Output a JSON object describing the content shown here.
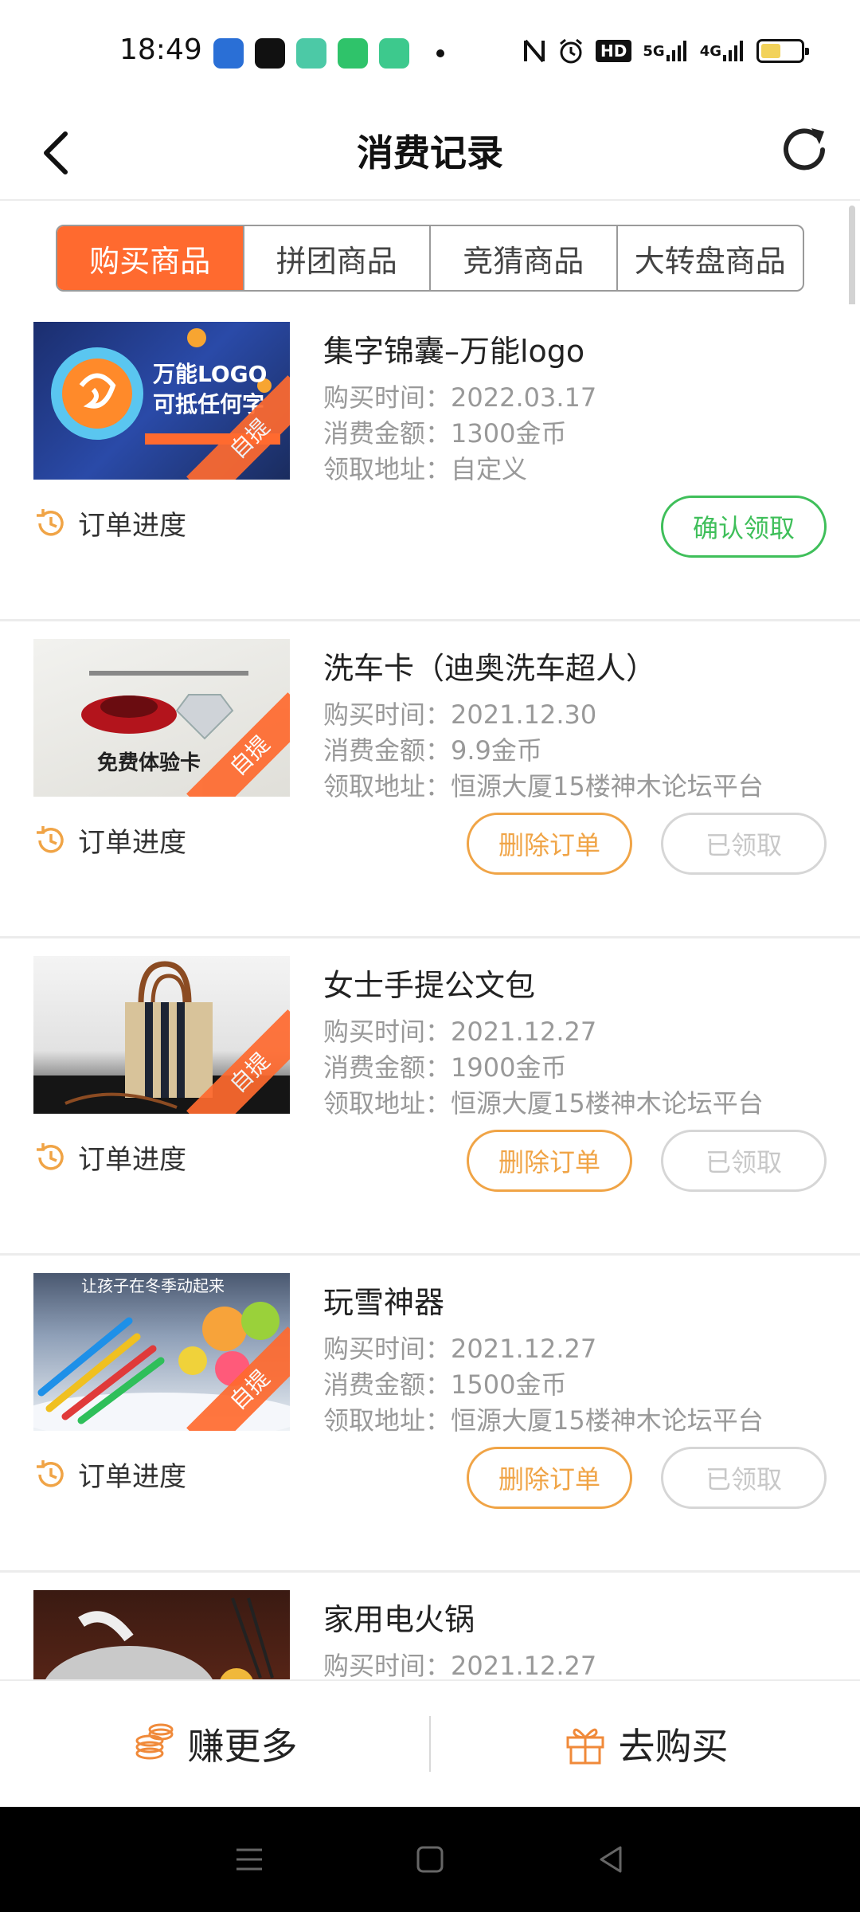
{
  "status_bar": {
    "time": "18:49",
    "icons": [
      "nfc-icon",
      "alarm-icon",
      "hd-icon",
      "5g-signal-icon",
      "4g-signal-icon",
      "battery-icon"
    ],
    "network_5g": "5G",
    "network_4g": "4G",
    "hd": "HD",
    "battery_level": 0.5
  },
  "header": {
    "title": "消费记录"
  },
  "tabs": [
    {
      "label": "购买商品",
      "active": true
    },
    {
      "label": "拼团商品",
      "active": false
    },
    {
      "label": "竞猜商品",
      "active": false
    },
    {
      "label": "大转盘商品",
      "active": false
    }
  ],
  "orders": [
    {
      "title": "集字锦囊–万能logo",
      "time": "购买时间：2022.03.17",
      "amount": "消费金额：1300金币",
      "address": "领取地址：自定义",
      "ribbon": "自提",
      "progress_label": "订单进度",
      "primary_button": "确认领取",
      "thumb_text_1": "万能LOGO",
      "thumb_text_2": "可抵任何字"
    },
    {
      "title": "洗车卡（迪奥洗车超人）",
      "time": "购买时间：2021.12.30",
      "amount": "消费金额：9.9金币",
      "address": "领取地址：恒源大厦15楼神木论坛平台",
      "ribbon": "自提",
      "progress_label": "订单进度",
      "delete_button": "删除订单",
      "status_button": "已领取",
      "thumb_text_1": "免费体验卡"
    },
    {
      "title": "女士手提公文包",
      "time": "购买时间：2021.12.27",
      "amount": "消费金额：1900金币",
      "address": "领取地址：恒源大厦15楼神木论坛平台",
      "ribbon": "自提",
      "progress_label": "订单进度",
      "delete_button": "删除订单",
      "status_button": "已领取"
    },
    {
      "title": "玩雪神器",
      "time": "购买时间：2021.12.27",
      "amount": "消费金额：1500金币",
      "address": "领取地址：恒源大厦15楼神木论坛平台",
      "ribbon": "自提",
      "progress_label": "订单进度",
      "delete_button": "删除订单",
      "status_button": "已领取",
      "thumb_text_1": "让孩子在冬季动起来"
    },
    {
      "title": "家用电火锅",
      "time": "购买时间：2021.12.27"
    }
  ],
  "bottom_bar": {
    "earn_label": "赚更多",
    "buy_label": "去购买"
  },
  "colors": {
    "accent": "#ff6a2f",
    "green": "#3fbf5a",
    "orange_button": "#f0a446",
    "disabled": "#c8c8c8"
  }
}
